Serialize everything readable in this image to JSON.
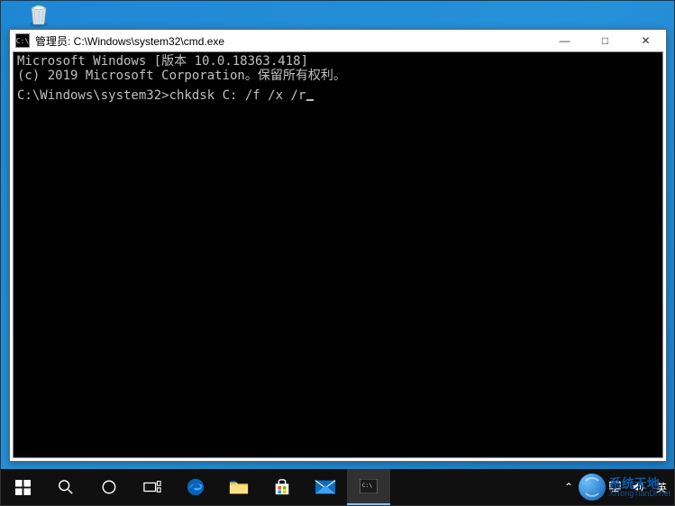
{
  "desktop": {
    "recycle_bin_name": "recycle-bin"
  },
  "window": {
    "title": "管理员: C:\\Windows\\system32\\cmd.exe",
    "icon_label": "C:\\",
    "console": {
      "line1": "Microsoft Windows [版本 10.0.18363.418]",
      "line2": "(c) 2019 Microsoft Corporation。保留所有权利。",
      "prompt": "C:\\Windows\\system32>",
      "command": "chkdsk C: /f /x /r"
    },
    "controls": {
      "minimize": "—",
      "maximize": "□",
      "close": "✕"
    }
  },
  "taskbar": {
    "tray": {
      "chevron": "⌃",
      "ime": "英"
    }
  },
  "watermark": {
    "title": "系统天地",
    "sub": "XiTongTianDi.net"
  }
}
